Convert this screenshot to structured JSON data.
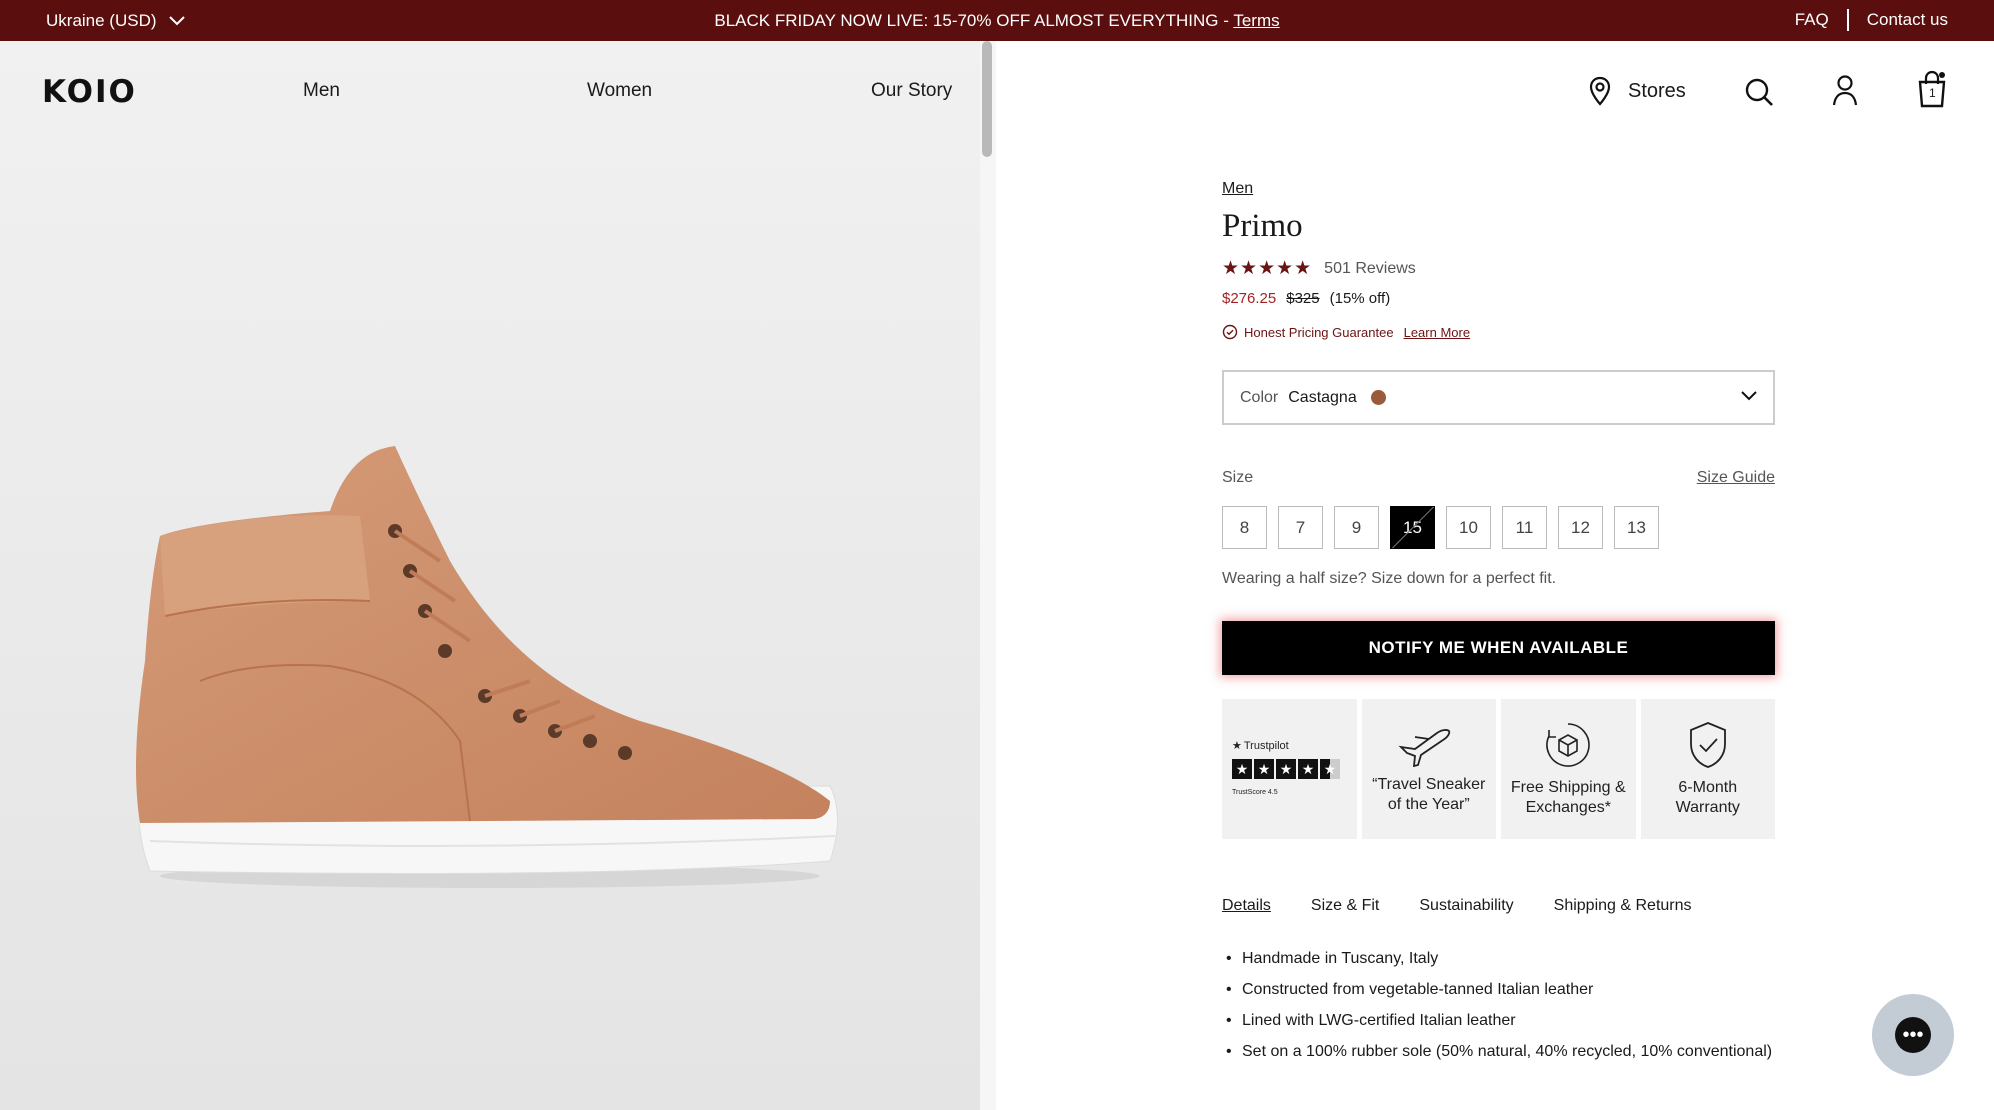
{
  "promo": {
    "region": "Ukraine (USD)",
    "message": "BLACK FRIDAY NOW LIVE: 15-70% OFF ALMOST EVERYTHING -",
    "terms": "Terms",
    "faq": "FAQ",
    "contact": "Contact us"
  },
  "header": {
    "logo": "KOIO",
    "nav": [
      "Men",
      "Women",
      "Our Story"
    ],
    "stores": "Stores",
    "cart_count": "1"
  },
  "product": {
    "breadcrumb": "Men",
    "name": "Primo",
    "rating": 5,
    "reviews": "501 Reviews",
    "sale_price": "$276.25",
    "original_price": "$325",
    "discount": "(15% off)",
    "guarantee": "Honest Pricing Guarantee",
    "learn_more": "Learn More",
    "color_label": "Color",
    "color_value": "Castagna",
    "swatch_color": "#9b5a3c",
    "size_label": "Size",
    "size_guide": "Size Guide",
    "sizes": [
      "8",
      "7",
      "9",
      "15",
      "10",
      "11",
      "12",
      "13"
    ],
    "selected_size": "15",
    "half_size_note": "Wearing a half size? Size down for a perfect fit.",
    "notify_button": "NOTIFY ME WHEN AVAILABLE"
  },
  "badges": {
    "trustpilot": "Trustpilot",
    "trustscore": "TrustScore 4.5",
    "travel": "“Travel Sneaker of the Year”",
    "shipping": "Free Shipping & Exchanges*",
    "warranty": "6-Month Warranty"
  },
  "tabs": [
    "Details",
    "Size & Fit",
    "Sustainability",
    "Shipping & Returns"
  ],
  "details": [
    "Handmade in Tuscany, Italy",
    "Constructed from vegetable-tanned Italian leather",
    "Lined with LWG-certified Italian leather",
    "Set on a 100% rubber sole (50% natural, 40% recycled, 10% conventional)"
  ],
  "colors": {
    "promo_bg": "#5a0e0e",
    "accent": "#6b1414",
    "sale": "#a32323"
  }
}
